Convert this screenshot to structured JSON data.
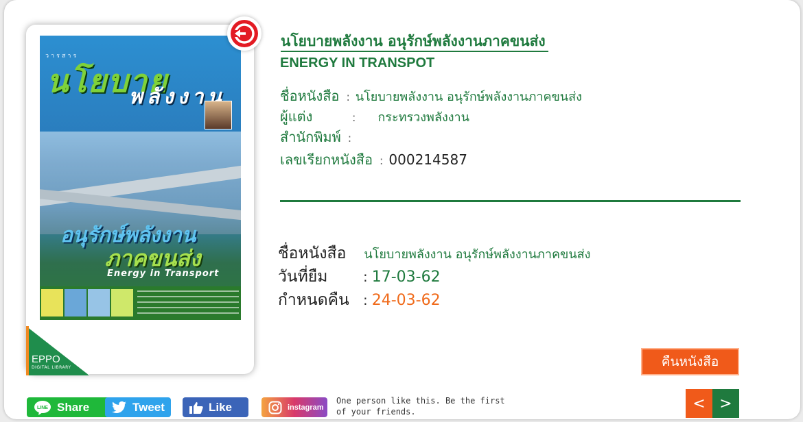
{
  "book": {
    "title_th": "นโยบายพลังงาน อนุรักษ์พลังงานภาคขนส่ง",
    "title_en": "ENERGY IN TRANSPOT",
    "details": [
      {
        "label": "ชื่อหนังสือ",
        "value": "นโยบายพลังงาน อนุรักษ์พลังงานภาคขนส่ง"
      },
      {
        "label": "ผู้แต่ง",
        "value": "กระทรวงพลังงาน"
      },
      {
        "label": "สำนักพิมพ์",
        "value": ""
      },
      {
        "label": "เลขเรียกหนังสือ",
        "value": "000214587"
      }
    ]
  },
  "cover": {
    "mag_label": "วารสาร",
    "title_line1": "นโยบาย",
    "title_line2": "พลังงาน",
    "headline1": "อนุรักษ์พลังงาน",
    "headline2": "ภาคขนส่ง",
    "headline3": "Energy in Transport"
  },
  "loan": {
    "title_label": "ชื่อหนังสือ",
    "title_value": "นโยบายพลังงาน อนุรักษ์พลังงานภาคขนส่ง",
    "borrow_label": "วันที่ยืม",
    "borrow_date": "17-03-62",
    "due_label": "กำหนดคืน",
    "due_date": "24-03-62"
  },
  "actions": {
    "return_label": "คืนหนังสือ",
    "prev": "<",
    "next": ">"
  },
  "brand": {
    "name": "EPPO",
    "sub": "DIGITAL LIBRARY"
  },
  "social": {
    "line": "Share",
    "twitter": "Tweet",
    "facebook": "Like",
    "instagram": "instagram",
    "fb_note": "One person like this. Be the first of your friends."
  },
  "colors": {
    "green": "#1f7a3e",
    "orange": "#f05a1a",
    "badge_red": "#e31b23"
  }
}
